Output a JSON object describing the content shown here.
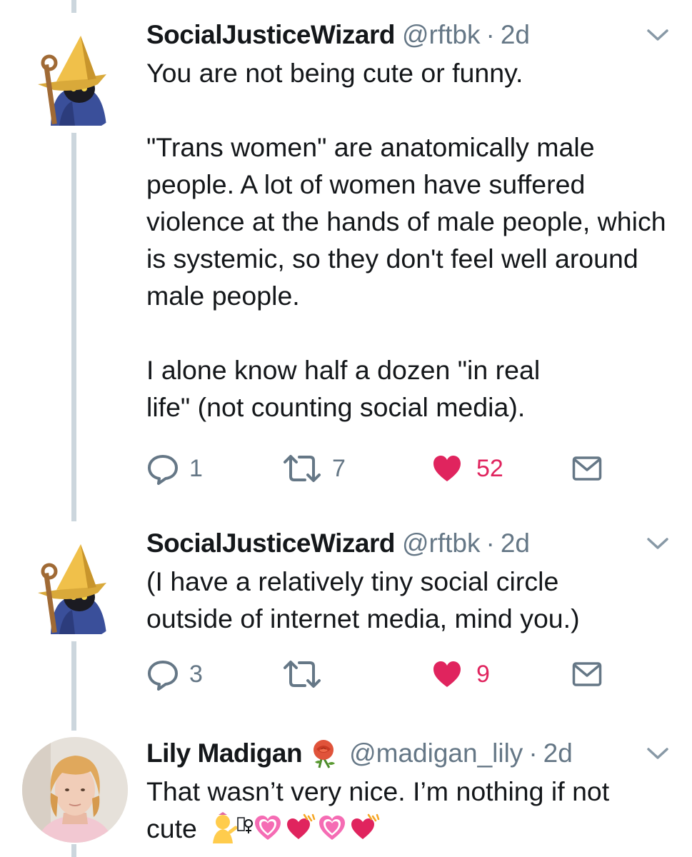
{
  "colors": {
    "thread_line": "#ccd6dd",
    "text": "#14171a",
    "secondary": "#657786",
    "like": "#e0245e"
  },
  "tweets": [
    {
      "name": "SocialJusticeWizard",
      "handle": "@rftbk",
      "separator": "·",
      "time": "2d",
      "avatar": "black-mage-wizard",
      "paragraphs": [
        "You are not being cute or funny.",
        "\"Trans women\" are anatomically male people. A lot of women have suffered violence at the hands of male people, which is systemic, so they don't feel well around male people.",
        "I alone know half a dozen \"in real life\" (not counting social media)."
      ],
      "replies": "1",
      "retweets": "7",
      "likes": "52"
    },
    {
      "name": "SocialJusticeWizard",
      "handle": "@rftbk",
      "separator": "·",
      "time": "2d",
      "avatar": "black-mage-wizard",
      "paragraphs": [
        "(I have a relatively tiny social circle outside of internet media, mind you.)"
      ],
      "replies": "3",
      "retweets": "",
      "likes": "9"
    },
    {
      "name": "Lily Madigan",
      "name_emoji": "rose-icon",
      "handle": "@madigan_lily",
      "separator": "·",
      "time": "2d",
      "avatar": "person-photo",
      "text_line1": "That wasn’t very nice. I’m nothing if not",
      "text_line2": "cute",
      "text_emojis": "💁‍♀💗💞💗💞"
    }
  ]
}
